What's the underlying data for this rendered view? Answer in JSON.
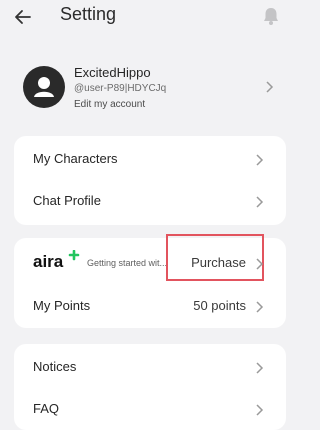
{
  "header": {
    "title": "Setting",
    "back_icon": "arrow-left-icon",
    "bell_icon": "bell-icon"
  },
  "profile": {
    "username": "ExcitedHippo",
    "user_id": "@user-P89|HDYCJq",
    "edit_label": "Edit my account",
    "avatar_icon": "person-icon"
  },
  "section1": {
    "my_characters": "My Characters",
    "chat_profile": "Chat Profile"
  },
  "section2": {
    "aira_logo_text": "aira",
    "aira_desc": "Getting started wit...",
    "purchase": "Purchase",
    "my_points": "My Points",
    "points_value": "50 points"
  },
  "section3": {
    "notices": "Notices",
    "faq": "FAQ"
  },
  "colors": {
    "background": "#f2f2f4",
    "card": "#ffffff",
    "aira_accent": "#22c55e",
    "highlight": "#e2545e"
  }
}
